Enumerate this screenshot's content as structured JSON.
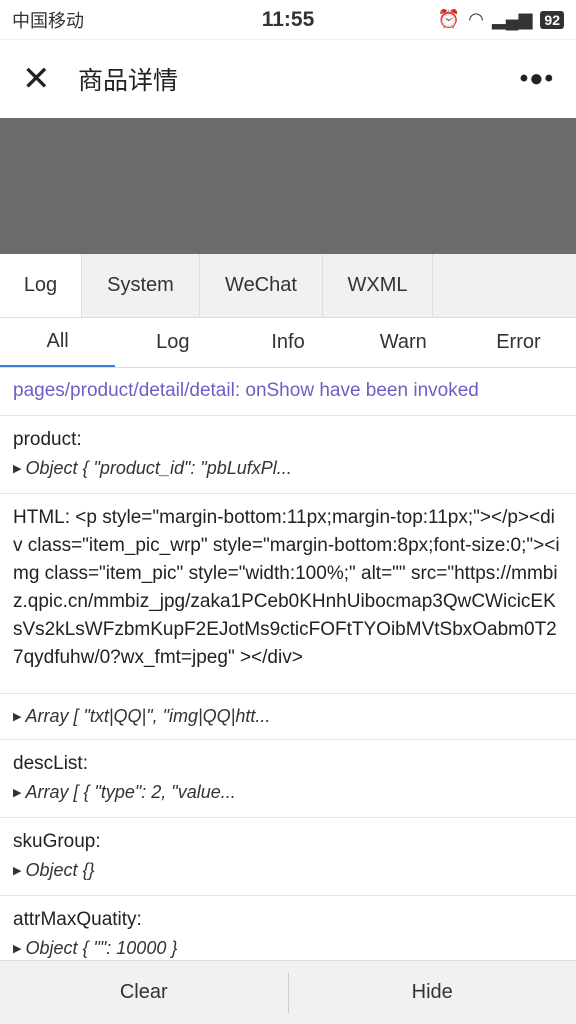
{
  "status": {
    "carrier": "中国移动",
    "time": "11:55",
    "battery": "92",
    "icons": [
      "alarm-icon",
      "wifi-icon",
      "signal-icon",
      "battery-icon"
    ]
  },
  "nav": {
    "title": "商品详情",
    "close_icon": "close-icon",
    "more_icon": "more-icon"
  },
  "tabs": [
    {
      "label": "Log"
    },
    {
      "label": "System"
    },
    {
      "label": "WeChat"
    },
    {
      "label": "WXML"
    }
  ],
  "subtabs": [
    {
      "label": "All"
    },
    {
      "label": "Log"
    },
    {
      "label": "Info"
    },
    {
      "label": "Warn"
    },
    {
      "label": "Error"
    }
  ],
  "logs": {
    "r0": "pages/product/detail/detail: onShow have been invoked",
    "r1_label": "product:",
    "r1_obj": "Object { \"product_id\": \"pbLufxPl...",
    "r2": "HTML: <p style=\"margin-bottom:11px;margin-top:11px;\"></p><div class=\"item_pic_wrp\" style=\"margin-bottom:8px;font-size:0;\"><img class=\"item_pic\" style=\"width:100%;\" alt=\"\" src=\"https://mmbiz.qpic.cn/mmbiz_jpg/zaka1PCeb0KHnhUibocmap3QwCWicicEKsVs2kLsWFzbmKupF2EJotMs9cticFOFtTYOibMVtSbxOabm0T27qydfuhw/0?wx_fmt=jpeg\" ></div>",
    "r3_obj": "Array [ \"txt|QQ|\", \"img|QQ|htt...",
    "r4_label": "descList:",
    "r4_obj": "Array [ { \"type\": 2, \"value...",
    "r5_label": "skuGroup:",
    "r5_obj": "Object {}",
    "r6_label": "attrMaxQuatity:",
    "r6_obj": "Object { \"\": 10000 }"
  },
  "footer": {
    "clear": "Clear",
    "hide": "Hide"
  },
  "colors": {
    "accent": "#3c7ee0",
    "link": "#6a5fc7"
  }
}
